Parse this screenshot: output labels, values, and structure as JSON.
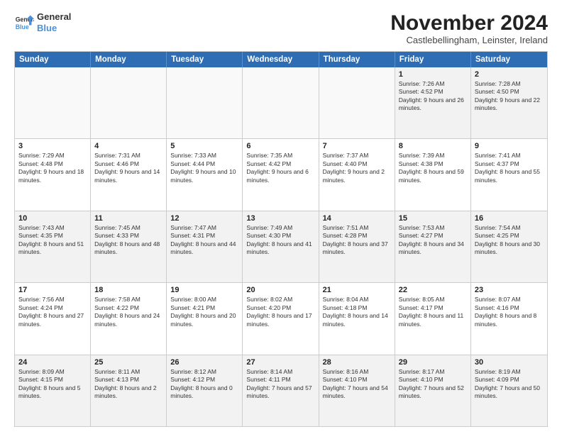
{
  "logo": {
    "line1": "General",
    "line2": "Blue"
  },
  "title": "November 2024",
  "subtitle": "Castlebellingham, Leinster, Ireland",
  "header": {
    "days": [
      "Sunday",
      "Monday",
      "Tuesday",
      "Wednesday",
      "Thursday",
      "Friday",
      "Saturday"
    ]
  },
  "weeks": [
    [
      {
        "day": "",
        "info": "",
        "empty": true
      },
      {
        "day": "",
        "info": "",
        "empty": true
      },
      {
        "day": "",
        "info": "",
        "empty": true
      },
      {
        "day": "",
        "info": "",
        "empty": true
      },
      {
        "day": "",
        "info": "",
        "empty": true
      },
      {
        "day": "1",
        "info": "Sunrise: 7:26 AM\nSunset: 4:52 PM\nDaylight: 9 hours and 26 minutes.",
        "empty": false
      },
      {
        "day": "2",
        "info": "Sunrise: 7:28 AM\nSunset: 4:50 PM\nDaylight: 9 hours and 22 minutes.",
        "empty": false
      }
    ],
    [
      {
        "day": "3",
        "info": "Sunrise: 7:29 AM\nSunset: 4:48 PM\nDaylight: 9 hours and 18 minutes.",
        "empty": false
      },
      {
        "day": "4",
        "info": "Sunrise: 7:31 AM\nSunset: 4:46 PM\nDaylight: 9 hours and 14 minutes.",
        "empty": false
      },
      {
        "day": "5",
        "info": "Sunrise: 7:33 AM\nSunset: 4:44 PM\nDaylight: 9 hours and 10 minutes.",
        "empty": false
      },
      {
        "day": "6",
        "info": "Sunrise: 7:35 AM\nSunset: 4:42 PM\nDaylight: 9 hours and 6 minutes.",
        "empty": false
      },
      {
        "day": "7",
        "info": "Sunrise: 7:37 AM\nSunset: 4:40 PM\nDaylight: 9 hours and 2 minutes.",
        "empty": false
      },
      {
        "day": "8",
        "info": "Sunrise: 7:39 AM\nSunset: 4:38 PM\nDaylight: 8 hours and 59 minutes.",
        "empty": false
      },
      {
        "day": "9",
        "info": "Sunrise: 7:41 AM\nSunset: 4:37 PM\nDaylight: 8 hours and 55 minutes.",
        "empty": false
      }
    ],
    [
      {
        "day": "10",
        "info": "Sunrise: 7:43 AM\nSunset: 4:35 PM\nDaylight: 8 hours and 51 minutes.",
        "empty": false
      },
      {
        "day": "11",
        "info": "Sunrise: 7:45 AM\nSunset: 4:33 PM\nDaylight: 8 hours and 48 minutes.",
        "empty": false
      },
      {
        "day": "12",
        "info": "Sunrise: 7:47 AM\nSunset: 4:31 PM\nDaylight: 8 hours and 44 minutes.",
        "empty": false
      },
      {
        "day": "13",
        "info": "Sunrise: 7:49 AM\nSunset: 4:30 PM\nDaylight: 8 hours and 41 minutes.",
        "empty": false
      },
      {
        "day": "14",
        "info": "Sunrise: 7:51 AM\nSunset: 4:28 PM\nDaylight: 8 hours and 37 minutes.",
        "empty": false
      },
      {
        "day": "15",
        "info": "Sunrise: 7:53 AM\nSunset: 4:27 PM\nDaylight: 8 hours and 34 minutes.",
        "empty": false
      },
      {
        "day": "16",
        "info": "Sunrise: 7:54 AM\nSunset: 4:25 PM\nDaylight: 8 hours and 30 minutes.",
        "empty": false
      }
    ],
    [
      {
        "day": "17",
        "info": "Sunrise: 7:56 AM\nSunset: 4:24 PM\nDaylight: 8 hours and 27 minutes.",
        "empty": false
      },
      {
        "day": "18",
        "info": "Sunrise: 7:58 AM\nSunset: 4:22 PM\nDaylight: 8 hours and 24 minutes.",
        "empty": false
      },
      {
        "day": "19",
        "info": "Sunrise: 8:00 AM\nSunset: 4:21 PM\nDaylight: 8 hours and 20 minutes.",
        "empty": false
      },
      {
        "day": "20",
        "info": "Sunrise: 8:02 AM\nSunset: 4:20 PM\nDaylight: 8 hours and 17 minutes.",
        "empty": false
      },
      {
        "day": "21",
        "info": "Sunrise: 8:04 AM\nSunset: 4:18 PM\nDaylight: 8 hours and 14 minutes.",
        "empty": false
      },
      {
        "day": "22",
        "info": "Sunrise: 8:05 AM\nSunset: 4:17 PM\nDaylight: 8 hours and 11 minutes.",
        "empty": false
      },
      {
        "day": "23",
        "info": "Sunrise: 8:07 AM\nSunset: 4:16 PM\nDaylight: 8 hours and 8 minutes.",
        "empty": false
      }
    ],
    [
      {
        "day": "24",
        "info": "Sunrise: 8:09 AM\nSunset: 4:15 PM\nDaylight: 8 hours and 5 minutes.",
        "empty": false
      },
      {
        "day": "25",
        "info": "Sunrise: 8:11 AM\nSunset: 4:13 PM\nDaylight: 8 hours and 2 minutes.",
        "empty": false
      },
      {
        "day": "26",
        "info": "Sunrise: 8:12 AM\nSunset: 4:12 PM\nDaylight: 8 hours and 0 minutes.",
        "empty": false
      },
      {
        "day": "27",
        "info": "Sunrise: 8:14 AM\nSunset: 4:11 PM\nDaylight: 7 hours and 57 minutes.",
        "empty": false
      },
      {
        "day": "28",
        "info": "Sunrise: 8:16 AM\nSunset: 4:10 PM\nDaylight: 7 hours and 54 minutes.",
        "empty": false
      },
      {
        "day": "29",
        "info": "Sunrise: 8:17 AM\nSunset: 4:10 PM\nDaylight: 7 hours and 52 minutes.",
        "empty": false
      },
      {
        "day": "30",
        "info": "Sunrise: 8:19 AM\nSunset: 4:09 PM\nDaylight: 7 hours and 50 minutes.",
        "empty": false
      }
    ]
  ]
}
